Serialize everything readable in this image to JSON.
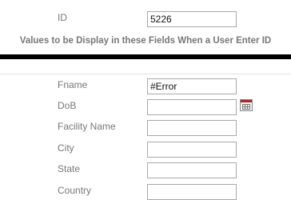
{
  "top_fields": {
    "id": {
      "label": "ID",
      "value": "5226"
    }
  },
  "banner": "Values to be Display in these Fields When a User Enter ID",
  "fields": {
    "fname": {
      "label": "Fname",
      "value": "#Error"
    },
    "dob": {
      "label": "DoB",
      "value": "",
      "icon": "calendar-icon"
    },
    "facility_name": {
      "label": "Facility Name",
      "value": ""
    },
    "city": {
      "label": "City",
      "value": ""
    },
    "state": {
      "label": "State",
      "value": ""
    },
    "country": {
      "label": "Country",
      "value": ""
    }
  }
}
